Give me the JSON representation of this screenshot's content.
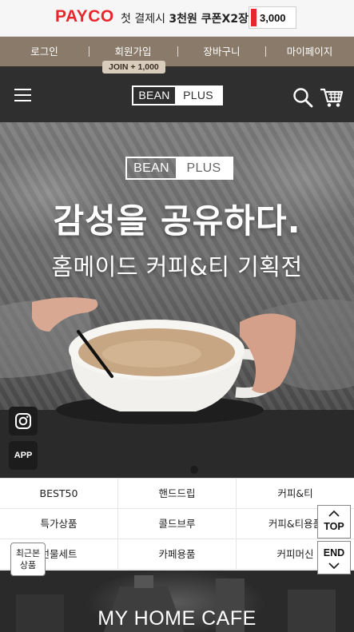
{
  "promo": {
    "brand": "PAYCO",
    "text_lead": "첫 결제시 ",
    "text_bold": "3천원 쿠폰X2장",
    "coupon_value": "3,000",
    "brand_color": "#e8262b"
  },
  "topnav": {
    "items": [
      {
        "label": "로그인"
      },
      {
        "label": "회원가입"
      },
      {
        "label": "장바구니"
      },
      {
        "label": "마이페이지"
      }
    ],
    "join_badge": "JOIN + 1,000",
    "bg_color": "#8a7a69"
  },
  "header": {
    "logo_left": "BEAN",
    "logo_right": "PLUS",
    "menu_icon": "hamburger-icon",
    "search_icon": "search-icon",
    "cart_icon": "cart-icon",
    "bg_color": "#2f2f2f"
  },
  "hero": {
    "logo_left": "BEAN",
    "logo_right": "PLUS",
    "title": "감성을 공유하다.",
    "subtitle": "홈메이드 커피&티 기획전",
    "social_instagram_icon": "instagram-icon",
    "social_app": "APP",
    "slide_count": 1,
    "active_slide": 1
  },
  "categories": [
    [
      "BEST50",
      "핸드드립",
      "커피&티"
    ],
    [
      "특가상품",
      "콜드브루",
      "커피&티용품"
    ],
    [
      "선물세트",
      "카페용품",
      "커피머신"
    ]
  ],
  "floating": {
    "top": "TOP",
    "end": "END",
    "recent_line1": "최근본",
    "recent_line2": "상품"
  },
  "bottom_banner": {
    "title": "MY HOME CAFE"
  }
}
